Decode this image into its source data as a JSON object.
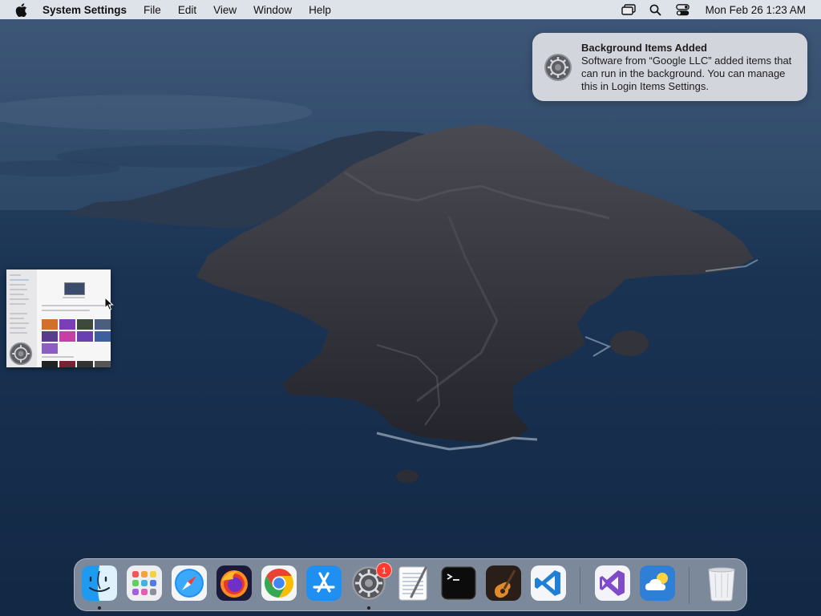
{
  "menubar": {
    "app_name": "System Settings",
    "items": [
      "File",
      "Edit",
      "View",
      "Window",
      "Help"
    ],
    "clock": "Mon Feb 26  1:23 AM"
  },
  "notification": {
    "title": "Background Items Added",
    "body": "Software from “Google LLC” added items that can run in the background. You can manage this in Login Items Settings.",
    "icon": "settings-gear-icon"
  },
  "dock": {
    "apps": [
      {
        "name": "finder",
        "running": true
      },
      {
        "name": "launchpad",
        "running": false
      },
      {
        "name": "safari",
        "running": false
      },
      {
        "name": "firefox",
        "running": false
      },
      {
        "name": "chrome",
        "running": false
      },
      {
        "name": "app-store",
        "running": false
      },
      {
        "name": "system-settings",
        "running": true,
        "badge": "1"
      },
      {
        "name": "textedit",
        "running": false
      },
      {
        "name": "terminal",
        "running": false
      },
      {
        "name": "garageband",
        "running": false
      },
      {
        "name": "vscode",
        "running": false
      },
      {
        "name": "visual-studio",
        "running": false
      },
      {
        "name": "weather",
        "running": false
      },
      {
        "name": "trash",
        "running": false
      }
    ]
  },
  "colors": {
    "badge": "#ff3b30",
    "menubar_bg": "#ebedf2"
  }
}
